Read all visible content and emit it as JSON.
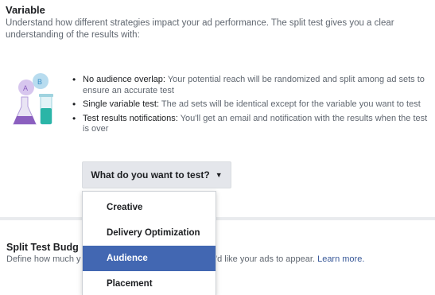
{
  "variable_section": {
    "title": "Variable",
    "description": "Understand how different strategies impact your ad performance. The split test gives you a clear understanding of the results with:",
    "illustration_icon": "beakers-ab-test-icon",
    "bullets": [
      {
        "lead": "No audience overlap:",
        "text": " Your potential reach will be randomized and split among ad sets to ensure an accurate test"
      },
      {
        "lead": "Single variable test:",
        "text": " The ad sets will be identical except for the variable you want to test"
      },
      {
        "lead": "Test results notifications:",
        "text": " You'll get an email and notification with the results when the test is over"
      }
    ],
    "test_button_label": "What do you want to test?"
  },
  "dropdown": {
    "options": [
      "Creative",
      "Delivery Optimization",
      "Audience",
      "Placement"
    ],
    "selected": "Audience"
  },
  "budget_section": {
    "title": "Split Test Budg",
    "description_start": "Define how much y",
    "description_end": "'d like your ads to appear.",
    "learn_more": "Learn more."
  },
  "colors": {
    "accent": "#4267b2",
    "link": "#385898",
    "button_bg": "#e4e6eb",
    "divider": "#e9ebee"
  }
}
